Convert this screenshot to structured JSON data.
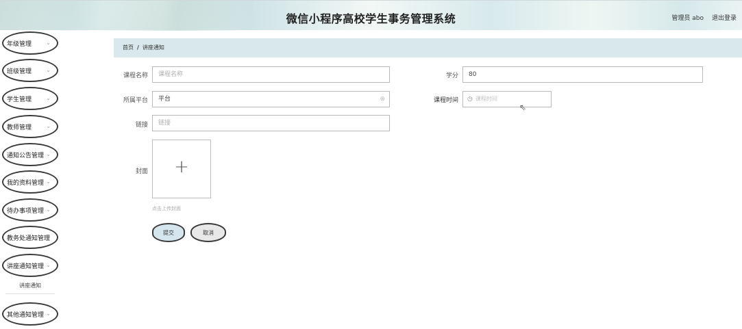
{
  "header": {
    "title": "微信小程序高校学生事务管理系统",
    "user": "管理员 abo",
    "logout": "退出登录"
  },
  "sidebar": {
    "items": [
      {
        "label": "年级管理"
      },
      {
        "label": "班级管理"
      },
      {
        "label": "学生管理"
      },
      {
        "label": "教师管理"
      },
      {
        "label": "通知公告管理"
      },
      {
        "label": "我的资料管理"
      },
      {
        "label": "待办事项管理"
      },
      {
        "label": "教务处通知管理"
      },
      {
        "label": "讲座通知管理"
      },
      {
        "label": "其他通知管理"
      }
    ],
    "sub_item": "讲座通知",
    "chevron": "⌄"
  },
  "breadcrumb": {
    "home": "首页",
    "separator": "/",
    "current": "讲座通知"
  },
  "form": {
    "course_name": {
      "label": "课程名称",
      "placeholder": "课程名称"
    },
    "credits": {
      "label": "学分",
      "value": "80"
    },
    "platform": {
      "label": "所属平台",
      "placeholder": "平台"
    },
    "course_time": {
      "label": "课程时间",
      "placeholder": "课程时间"
    },
    "link": {
      "label": "链接",
      "placeholder": "链接"
    },
    "cover": {
      "label": "封面",
      "hint": "点击上传封面"
    },
    "submit": "提交",
    "cancel": "取消"
  },
  "colors": {
    "breadcrumb_bg": "#d9e8ec",
    "submit_bg": "#d6e6ee",
    "cancel_bg": "#e8e8e8"
  }
}
